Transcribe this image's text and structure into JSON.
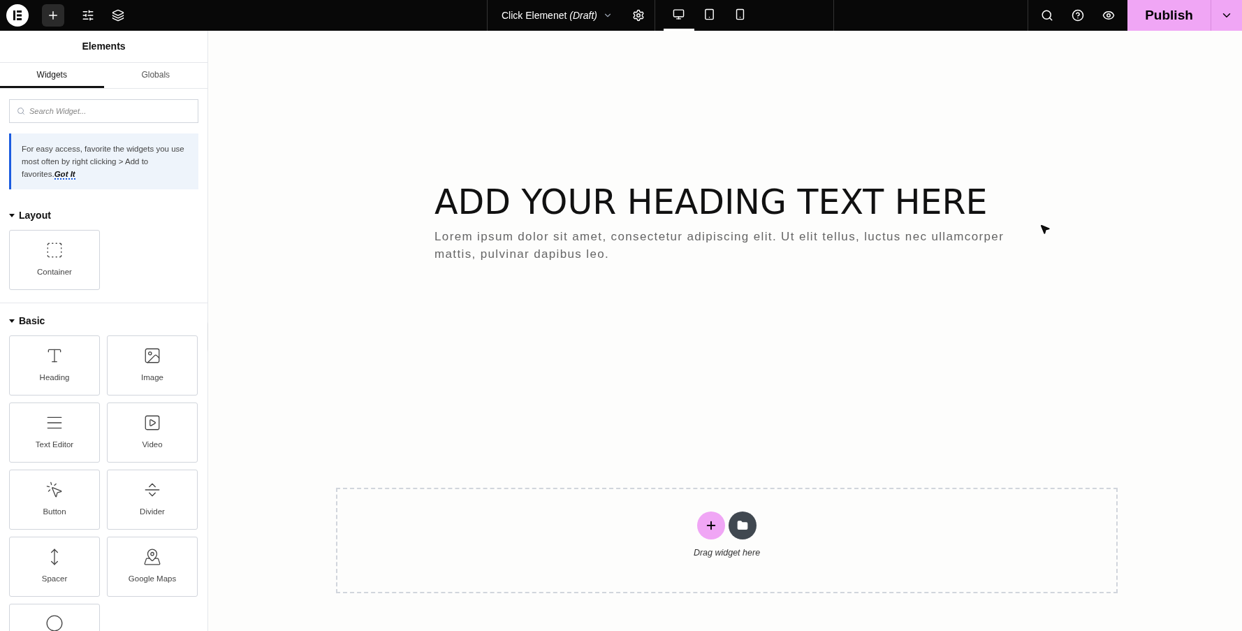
{
  "top_bar": {
    "document_title": "Click Elemenet",
    "document_status": "(Draft)",
    "devices": [
      {
        "kind": "desktop",
        "selected": true
      },
      {
        "kind": "tablet",
        "selected": false
      },
      {
        "kind": "mobile",
        "selected": false
      }
    ],
    "publish_button": "Publish"
  },
  "sidebar": {
    "title": "Elements",
    "tabs": [
      {
        "label": "Widgets",
        "selected": true
      },
      {
        "label": "Globals",
        "selected": false
      }
    ],
    "search": {
      "placeholder": "Search Widget..."
    },
    "tip": {
      "text": "For easy access, favorite the widgets you use most often by right clicking > Add to favorites.",
      "link": "Got It"
    },
    "sections": [
      {
        "title": "Layout",
        "expanded": true,
        "widgets": [
          {
            "kind": "container",
            "label": "Container"
          }
        ]
      },
      {
        "title": "Basic",
        "expanded": true,
        "widgets": [
          {
            "kind": "heading",
            "label": "Heading"
          },
          {
            "kind": "image",
            "label": "Image"
          },
          {
            "kind": "text",
            "label": "Text Editor"
          },
          {
            "kind": "video",
            "label": "Video"
          },
          {
            "kind": "button",
            "label": "Button"
          },
          {
            "kind": "divider",
            "label": "Divider"
          },
          {
            "kind": "spacer",
            "label": "Spacer"
          },
          {
            "kind": "map",
            "label": "Google Maps"
          }
        ]
      }
    ]
  },
  "canvas": {
    "heading": "ADD YOUR HEADING TEXT HERE",
    "paragraph": "Lorem ipsum dolor sit amet, consectetur adipiscing elit. Ut elit tellus, luctus nec ullamcorper mattis, pulvinar dapibus leo.",
    "drop_zone": {
      "hint": "Drag widget here"
    }
  }
}
